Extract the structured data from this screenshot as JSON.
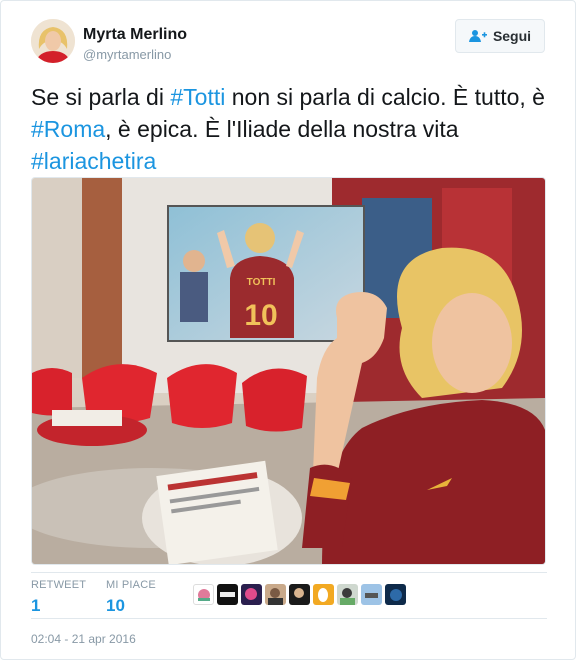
{
  "tweet": {
    "author_name": "Myrta Merlino",
    "author_handle": "@myrtamerlino",
    "follow_label": "Segui",
    "text": {
      "p1": "Se si parla di ",
      "tag1": "#Totti",
      "p2": " non si parla di calcio. È tutto, è ",
      "tag2": "#Roma",
      "p3": ", è epica. È l'Iliade della nostra vita ",
      "tag3": "#lariachetira"
    },
    "media_scene": {
      "screen_shirt_text": "TOTTI",
      "screen_shirt_number": "10"
    },
    "stats": {
      "retweet_label": "RETWEET",
      "retweet_count": "1",
      "likes_label": "MI PIACE",
      "likes_count": "10"
    },
    "timestamp": "02:04 - 21 apr 2016"
  },
  "colors": {
    "link": "#1b95e0",
    "text": "#14171a",
    "muted": "#8899a6",
    "border": "#e1e8ed"
  },
  "icons": {
    "follow": "follow-person-plus-icon"
  }
}
